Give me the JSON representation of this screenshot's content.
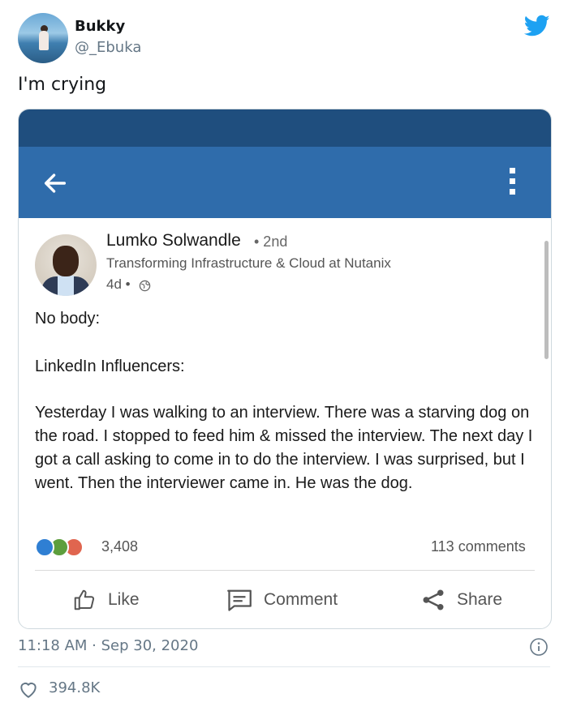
{
  "tweet": {
    "author_name": "Bukky",
    "author_handle": "@_Ebuka",
    "text": "I'm crying",
    "timestamp": "11:18 AM · Sep 30, 2020",
    "likes": "394.8K",
    "brand_color": "#1da1f2"
  },
  "embedded_screenshot": {
    "app_bar_color": "#2f6cab",
    "status_bar_color": "#1f4e7e",
    "post": {
      "author_name": "Lumko Solwandle",
      "degree": "• 2nd",
      "headline": "Transforming Infrastructure & Cloud at Nutanix",
      "age": "4d •",
      "body_line_1": "No body:",
      "body_line_2": "LinkedIn Influencers:",
      "body_line_3": "Yesterday I was walking to an interview. There was a starving dog on the road. I stopped to feed him & missed the interview. The next day I got a call asking to come in to do the interview. I was surprised, but I went. Then the interviewer came in. He was the dog.",
      "reactions_count": "3,408",
      "comments_count": "113 comments"
    },
    "actions": {
      "like": "Like",
      "comment": "Comment",
      "share": "Share"
    }
  }
}
